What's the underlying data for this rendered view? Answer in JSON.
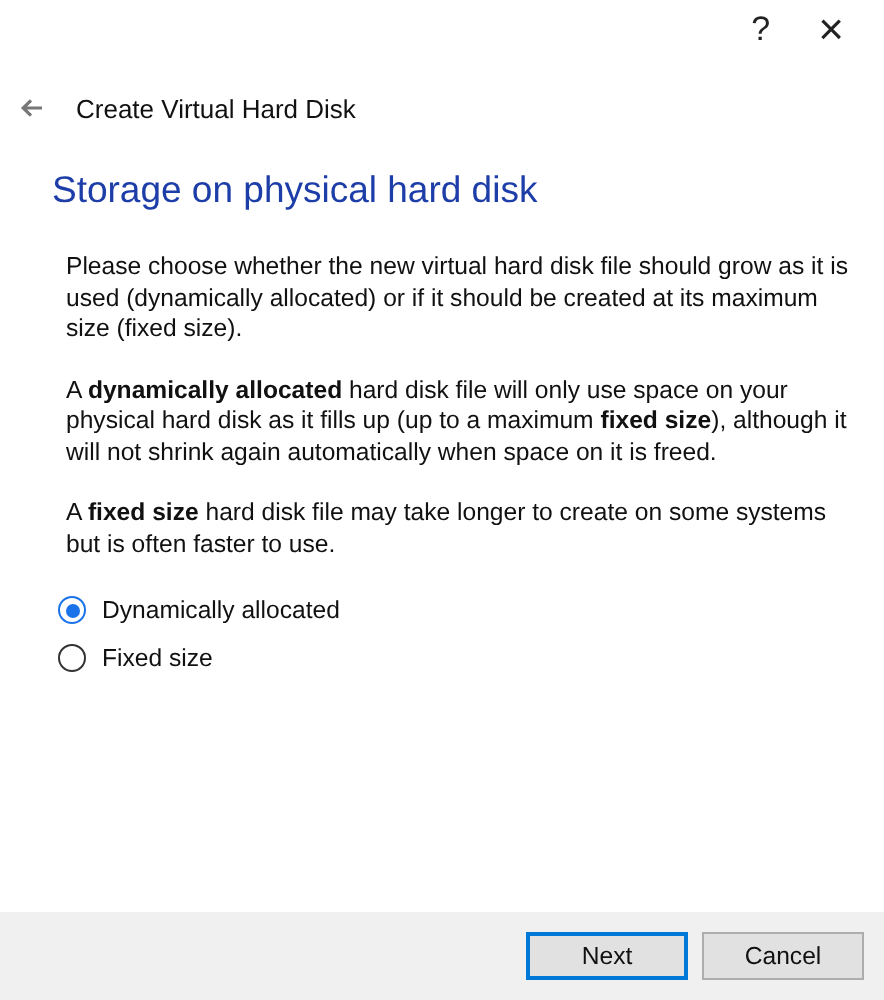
{
  "title_bar": {
    "help": "?",
    "close": "×"
  },
  "header": {
    "title": "Create Virtual Hard Disk"
  },
  "heading": "Storage on physical hard disk",
  "paragraphs": [
    "Please choose whether the new virtual hard disk file should grow as it is used (dynamically allocated) or if it should be created at its maximum size (fixed size).",
    "A **dynamically allocated** hard disk file will only use space on your physical hard disk as it fills up (up to a maximum **fixed size**), although it will not shrink again automatically when space on it is freed.",
    "A **fixed size** hard disk file may take longer to create on some systems but is often faster to use."
  ],
  "options": [
    {
      "label": "Dynamically allocated",
      "selected": true
    },
    {
      "label": "Fixed size",
      "selected": false
    }
  ],
  "buttons": [
    {
      "label": "Next",
      "focused": true
    },
    {
      "label": "Cancel",
      "focused": false
    }
  ]
}
